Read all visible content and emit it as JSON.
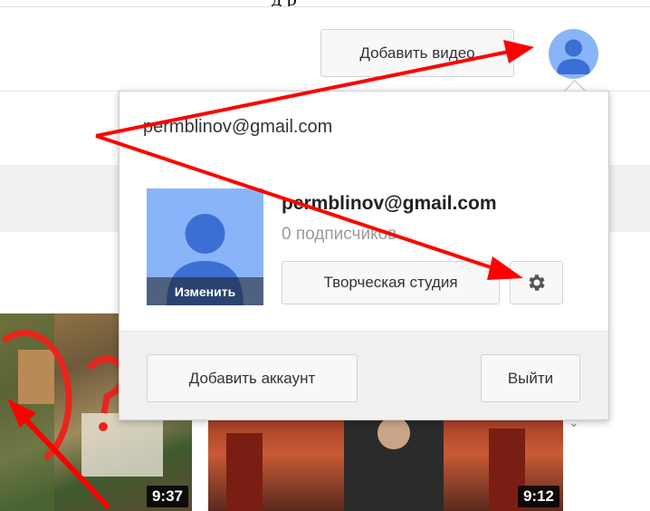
{
  "caption_fragment": "д                  р",
  "masthead": {
    "upload_label": "Добавить видео",
    "avatar_icon": "user-avatar-icon"
  },
  "popup": {
    "email": "permblinov@gmail.com",
    "account_name": "permblinov@gmail.com",
    "subscribers": "0 подписчиков",
    "edit_label": "Изменить",
    "studio_label": "Творческая студия",
    "settings_icon": "gear-icon",
    "add_account_label": "Добавить аккаунт",
    "logout_label": "Выйти"
  },
  "videos": [
    {
      "duration": "9:37"
    },
    {
      "duration": "9:12"
    }
  ],
  "annotations": {
    "arrow_color": "#ff0000"
  }
}
